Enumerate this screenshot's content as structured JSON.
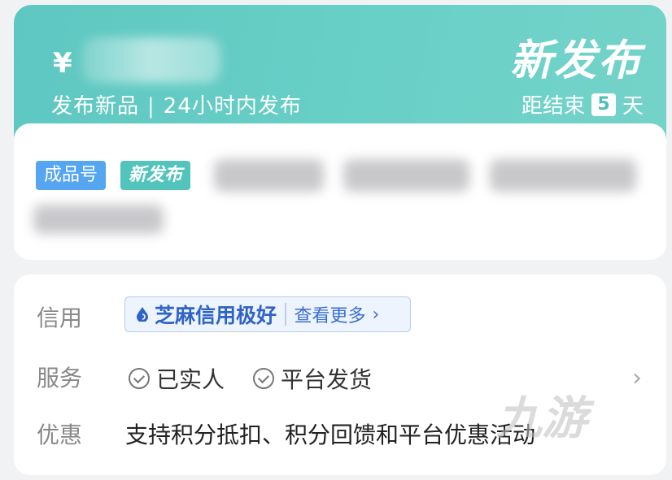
{
  "header": {
    "currency_symbol": "¥",
    "subtitle_left": "发布新品",
    "subtitle_right": "24小时内发布",
    "title": "新发布",
    "countdown_prefix": "距结束",
    "countdown_days": "5",
    "countdown_suffix": "天"
  },
  "listing": {
    "tag_type": "成品号",
    "tag_new": "新发布"
  },
  "details": {
    "credit_label": "信用",
    "credit_badge": "芝麻信用极好",
    "credit_more": "查看更多",
    "service_label": "服务",
    "services": [
      "已实人",
      "平台发货"
    ],
    "discount_label": "优惠",
    "discount_text": "支持积分抵扣、积分回馈和平台优惠活动"
  },
  "watermark": "九游",
  "colors": {
    "header_teal": "#64cbc4",
    "tag_blue": "#55a5f0",
    "tag_teal": "#52c4bc",
    "credit_blue": "#2f63c7"
  }
}
